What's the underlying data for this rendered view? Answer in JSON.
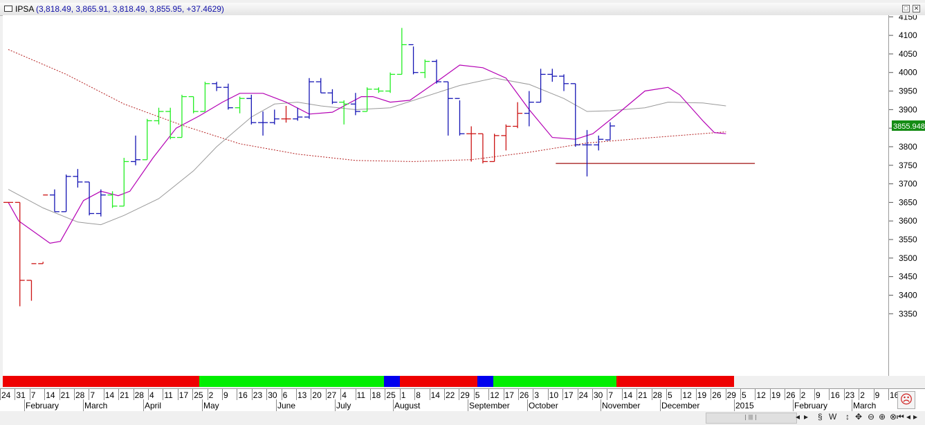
{
  "window": {
    "symbol": "IPSA",
    "values_text": "(3,818.49, 3,865.91, 3,818.49, 3,855.95, +37.4629)",
    "restore_glyph": "□",
    "close_glyph": "✕"
  },
  "chart_data": {
    "type": "ohlc",
    "last_price_label": "3855.948",
    "y_axis_ticks": [
      3350,
      3400,
      3450,
      3500,
      3550,
      3600,
      3650,
      3700,
      3750,
      3800,
      3850,
      3900,
      3950,
      4000,
      4050,
      4100,
      4150
    ],
    "ylim": [
      3300,
      4180
    ],
    "bar_colors": {
      "up": "#22ee22",
      "down": "#1414b4",
      "red": "#cc1414"
    },
    "bars": [
      {
        "d": "2013-12-27",
        "o": 3650,
        "h": 3650,
        "l": 3650,
        "c": 3650,
        "col": "red"
      },
      {
        "d": "2013-12-31",
        "o": 3650,
        "h": 3650,
        "l": 3370,
        "c": 3440,
        "col": "red"
      },
      {
        "d": "2014-01-07",
        "o": 3440,
        "h": 3440,
        "l": 3385,
        "c": 3485,
        "col": "red"
      },
      {
        "d": "2014-01-14",
        "o": 3485,
        "h": 3490,
        "l": 3485,
        "c": 3670,
        "col": "red"
      },
      {
        "d": "2014-01-21",
        "o": 3670,
        "h": 3685,
        "l": 3625,
        "c": 3625,
        "col": "down"
      },
      {
        "d": "2014-01-28",
        "o": 3625,
        "h": 3725,
        "l": 3625,
        "c": 3720,
        "col": "down"
      },
      {
        "d": "2014-02-04",
        "o": 3720,
        "h": 3740,
        "l": 3690,
        "c": 3705,
        "col": "down"
      },
      {
        "d": "2014-02-11",
        "o": 3705,
        "h": 3705,
        "l": 3615,
        "c": 3620,
        "col": "down"
      },
      {
        "d": "2014-02-18",
        "o": 3620,
        "h": 3685,
        "l": 3612,
        "c": 3670,
        "col": "down"
      },
      {
        "d": "2014-02-25",
        "o": 3670,
        "h": 3680,
        "l": 3635,
        "c": 3640,
        "col": "up"
      },
      {
        "d": "2014-03-04",
        "o": 3640,
        "h": 3770,
        "l": 3640,
        "c": 3760,
        "col": "up"
      },
      {
        "d": "2014-03-11",
        "o": 3760,
        "h": 3830,
        "l": 3750,
        "c": 3765,
        "col": "down"
      },
      {
        "d": "2014-03-18",
        "o": 3765,
        "h": 3875,
        "l": 3765,
        "c": 3870,
        "col": "up"
      },
      {
        "d": "2014-03-25",
        "o": 3870,
        "h": 3905,
        "l": 3860,
        "c": 3895,
        "col": "up"
      },
      {
        "d": "2014-04-01",
        "o": 3895,
        "h": 3905,
        "l": 3820,
        "c": 3825,
        "col": "up"
      },
      {
        "d": "2014-04-08",
        "o": 3825,
        "h": 3940,
        "l": 3825,
        "c": 3935,
        "col": "up"
      },
      {
        "d": "2014-04-15",
        "o": 3935,
        "h": 3935,
        "l": 3890,
        "c": 3895,
        "col": "up"
      },
      {
        "d": "2014-04-22",
        "o": 3895,
        "h": 3975,
        "l": 3895,
        "c": 3970,
        "col": "up"
      },
      {
        "d": "2014-04-29",
        "o": 3970,
        "h": 3975,
        "l": 3950,
        "c": 3960,
        "col": "down"
      },
      {
        "d": "2014-05-06",
        "o": 3960,
        "h": 3970,
        "l": 3900,
        "c": 3905,
        "col": "down"
      },
      {
        "d": "2014-05-13",
        "o": 3905,
        "h": 3935,
        "l": 3890,
        "c": 3930,
        "col": "up"
      },
      {
        "d": "2014-05-20",
        "o": 3930,
        "h": 3940,
        "l": 3860,
        "c": 3865,
        "col": "down"
      },
      {
        "d": "2014-05-27",
        "o": 3865,
        "h": 3895,
        "l": 3830,
        "c": 3865,
        "col": "down"
      },
      {
        "d": "2014-06-03",
        "o": 3865,
        "h": 3900,
        "l": 3860,
        "c": 3875,
        "col": "down"
      },
      {
        "d": "2014-06-10",
        "o": 3875,
        "h": 3910,
        "l": 3865,
        "c": 3875,
        "col": "red"
      },
      {
        "d": "2014-06-17",
        "o": 3875,
        "h": 3905,
        "l": 3870,
        "c": 3880,
        "col": "down"
      },
      {
        "d": "2014-06-24",
        "o": 3880,
        "h": 3985,
        "l": 3875,
        "c": 3975,
        "col": "down"
      },
      {
        "d": "2014-07-01",
        "o": 3975,
        "h": 3985,
        "l": 3945,
        "c": 3945,
        "col": "down"
      },
      {
        "d": "2014-07-08",
        "o": 3945,
        "h": 3955,
        "l": 3915,
        "c": 3920,
        "col": "down"
      },
      {
        "d": "2014-07-15",
        "o": 3920,
        "h": 3925,
        "l": 3860,
        "c": 3915,
        "col": "up"
      },
      {
        "d": "2014-07-22",
        "o": 3915,
        "h": 3945,
        "l": 3885,
        "c": 3895,
        "col": "down"
      },
      {
        "d": "2014-07-29",
        "o": 3895,
        "h": 3960,
        "l": 3895,
        "c": 3955,
        "col": "up"
      },
      {
        "d": "2014-08-05",
        "o": 3955,
        "h": 3960,
        "l": 3945,
        "c": 3950,
        "col": "up"
      },
      {
        "d": "2014-08-12",
        "o": 3950,
        "h": 4000,
        "l": 3945,
        "c": 3995,
        "col": "up"
      },
      {
        "d": "2014-08-19",
        "o": 3995,
        "h": 4120,
        "l": 3995,
        "c": 4075,
        "col": "up"
      },
      {
        "d": "2014-08-26",
        "o": 4075,
        "h": 4070,
        "l": 3995,
        "c": 4000,
        "col": "down"
      },
      {
        "d": "2014-09-02",
        "o": 4000,
        "h": 4035,
        "l": 3985,
        "c": 4030,
        "col": "up"
      },
      {
        "d": "2014-09-09",
        "o": 4030,
        "h": 4035,
        "l": 3970,
        "c": 3975,
        "col": "down"
      },
      {
        "d": "2014-09-16",
        "o": 3975,
        "h": 3975,
        "l": 3830,
        "c": 3930,
        "col": "down"
      },
      {
        "d": "2014-09-23",
        "o": 3930,
        "h": 3925,
        "l": 3830,
        "c": 3835,
        "col": "down"
      },
      {
        "d": "2014-09-30",
        "o": 3835,
        "h": 3855,
        "l": 3760,
        "c": 3835,
        "col": "red"
      },
      {
        "d": "2014-10-07",
        "o": 3835,
        "h": 3835,
        "l": 3755,
        "c": 3760,
        "col": "red"
      },
      {
        "d": "2014-10-14",
        "o": 3760,
        "h": 3835,
        "l": 3760,
        "c": 3830,
        "col": "red"
      },
      {
        "d": "2014-10-21",
        "o": 3830,
        "h": 3860,
        "l": 3790,
        "c": 3855,
        "col": "red"
      },
      {
        "d": "2014-10-28",
        "o": 3855,
        "h": 3920,
        "l": 3850,
        "c": 3890,
        "col": "red"
      },
      {
        "d": "2014-11-04",
        "o": 3890,
        "h": 3950,
        "l": 3855,
        "c": 3920,
        "col": "down"
      },
      {
        "d": "2014-11-11",
        "o": 3920,
        "h": 4010,
        "l": 3920,
        "c": 3995,
        "col": "down"
      },
      {
        "d": "2014-11-18",
        "o": 3995,
        "h": 4010,
        "l": 3975,
        "c": 3990,
        "col": "down"
      },
      {
        "d": "2014-11-25",
        "o": 3990,
        "h": 3995,
        "l": 3950,
        "c": 3970,
        "col": "down"
      },
      {
        "d": "2014-12-02",
        "o": 3970,
        "h": 3970,
        "l": 3800,
        "c": 3805,
        "col": "down"
      },
      {
        "d": "2014-12-09",
        "o": 3805,
        "h": 3845,
        "l": 3720,
        "c": 3805,
        "col": "down"
      },
      {
        "d": "2014-12-16",
        "o": 3805,
        "h": 3830,
        "l": 3790,
        "c": 3820,
        "col": "down"
      },
      {
        "d": "2014-12-23",
        "o": 3818.49,
        "h": 3865.91,
        "l": 3818.49,
        "c": 3855.95,
        "col": "down"
      }
    ],
    "ma_fast": [
      [
        0,
        3650
      ],
      [
        0.9,
        3600
      ],
      [
        3.6,
        3540
      ],
      [
        4.5,
        3545
      ],
      [
        6.5,
        3655
      ],
      [
        8,
        3680
      ],
      [
        9.5,
        3668
      ],
      [
        10.5,
        3680
      ],
      [
        12.5,
        3770
      ],
      [
        14.5,
        3850
      ],
      [
        16.5,
        3883
      ],
      [
        18.5,
        3920
      ],
      [
        20,
        3944
      ],
      [
        22,
        3944
      ],
      [
        24,
        3920
      ],
      [
        26,
        3888
      ],
      [
        28,
        3893
      ],
      [
        30.5,
        3935
      ],
      [
        31.5,
        3935
      ],
      [
        33,
        3920
      ],
      [
        34.7,
        3925
      ],
      [
        37,
        3975
      ],
      [
        39,
        4020
      ],
      [
        41,
        4013
      ],
      [
        43,
        3985
      ],
      [
        45,
        3900
      ],
      [
        47,
        3825
      ],
      [
        49,
        3820
      ],
      [
        50.5,
        3835
      ],
      [
        52.5,
        3885
      ],
      [
        55,
        3950
      ],
      [
        57,
        3960
      ],
      [
        58,
        3940
      ],
      [
        60,
        3870
      ],
      [
        61,
        3838
      ],
      [
        62,
        3835
      ]
    ],
    "ma_slow": [
      [
        0,
        3685
      ],
      [
        3,
        3635
      ],
      [
        6,
        3597
      ],
      [
        8,
        3590
      ],
      [
        10,
        3615
      ],
      [
        13,
        3660
      ],
      [
        16,
        3735
      ],
      [
        18,
        3800
      ],
      [
        21,
        3880
      ],
      [
        23,
        3915
      ],
      [
        25,
        3920
      ],
      [
        27,
        3910
      ],
      [
        30,
        3900
      ],
      [
        33,
        3905
      ],
      [
        36,
        3935
      ],
      [
        39,
        3965
      ],
      [
        42,
        3985
      ],
      [
        45,
        3968
      ],
      [
        48,
        3930
      ],
      [
        50,
        3895
      ],
      [
        52,
        3897
      ],
      [
        55,
        3905
      ],
      [
        57,
        3920
      ],
      [
        60,
        3918
      ],
      [
        62,
        3910
      ]
    ],
    "ma_long": [
      [
        0,
        4062
      ],
      [
        5,
        3995
      ],
      [
        10,
        3915
      ],
      [
        15,
        3858
      ],
      [
        20,
        3808
      ],
      [
        25,
        3780
      ],
      [
        30,
        3763
      ],
      [
        35,
        3760
      ],
      [
        40,
        3765
      ],
      [
        45,
        3785
      ],
      [
        50,
        3810
      ],
      [
        55,
        3823
      ],
      [
        62,
        3840
      ]
    ],
    "support_line": {
      "value": 3755,
      "from_index": 47.3,
      "to_index": 64.5
    }
  },
  "strip": [
    {
      "color": "#ee0000",
      "from": 0,
      "to": 19.6
    },
    {
      "color": "#00ee00",
      "from": 19.6,
      "to": 38
    },
    {
      "color": "#0000ee",
      "from": 38,
      "to": 39.6
    },
    {
      "color": "#ee0000",
      "from": 39.6,
      "to": 47.3
    },
    {
      "color": "#0000ee",
      "from": 47.3,
      "to": 48.9
    },
    {
      "color": "#00ee00",
      "from": 48.9,
      "to": 61.2
    },
    {
      "color": "#ee0000",
      "from": 61.2,
      "to": 72.9
    }
  ],
  "time_axis": {
    "days": [
      "24",
      "31",
      "7",
      "14",
      "21",
      "28",
      "7",
      "14",
      "21",
      "28",
      "4",
      "11",
      "17",
      "25",
      "2",
      "9",
      "16",
      "23",
      "30",
      "6",
      "13",
      "20",
      "27",
      "4",
      "11",
      "18",
      "25",
      "1",
      "8",
      "14",
      "22",
      "29",
      "5",
      "12",
      "17",
      "26",
      "3",
      "10",
      "17",
      "24",
      "30",
      "7",
      "14",
      "21",
      "28",
      "5",
      "12",
      "19",
      "26",
      "29",
      "5",
      "12",
      "19",
      "26",
      "2",
      "9",
      "16",
      "23",
      "2",
      "9",
      "16"
    ],
    "months": [
      {
        "label": "February",
        "at": 1
      },
      {
        "label": "March",
        "at": 6
      },
      {
        "label": "April",
        "at": 10
      },
      {
        "label": "May",
        "at": 14
      },
      {
        "label": "June",
        "at": 19
      },
      {
        "label": "July",
        "at": 23
      },
      {
        "label": "August",
        "at": 27
      },
      {
        "label": "September",
        "at": 32
      },
      {
        "label": "October",
        "at": 36
      },
      {
        "label": "November",
        "at": 41
      },
      {
        "label": "December",
        "at": 45
      },
      {
        "label": "2015",
        "at": 50
      },
      {
        "label": "February",
        "at": 54
      },
      {
        "label": "March",
        "at": 58
      }
    ]
  },
  "status": {
    "icons": [
      "scroll-left-icon",
      "scroll-right-icon",
      "s-icon",
      "w-icon",
      "m-icon",
      "fit-icon",
      "zoom-out-icon",
      "zoom-in-icon",
      "zoom-reset-icon",
      "prev-icon",
      "back-icon",
      "forward-icon",
      "next-icon"
    ],
    "glyphs": [
      "◂",
      "▸",
      "§",
      "W",
      "↕",
      "✥",
      "⊖",
      "⊕",
      "⊗",
      "⏮",
      "◂",
      "▸",
      "⏭"
    ],
    "thumb": "|||",
    "smiley": "☹"
  }
}
